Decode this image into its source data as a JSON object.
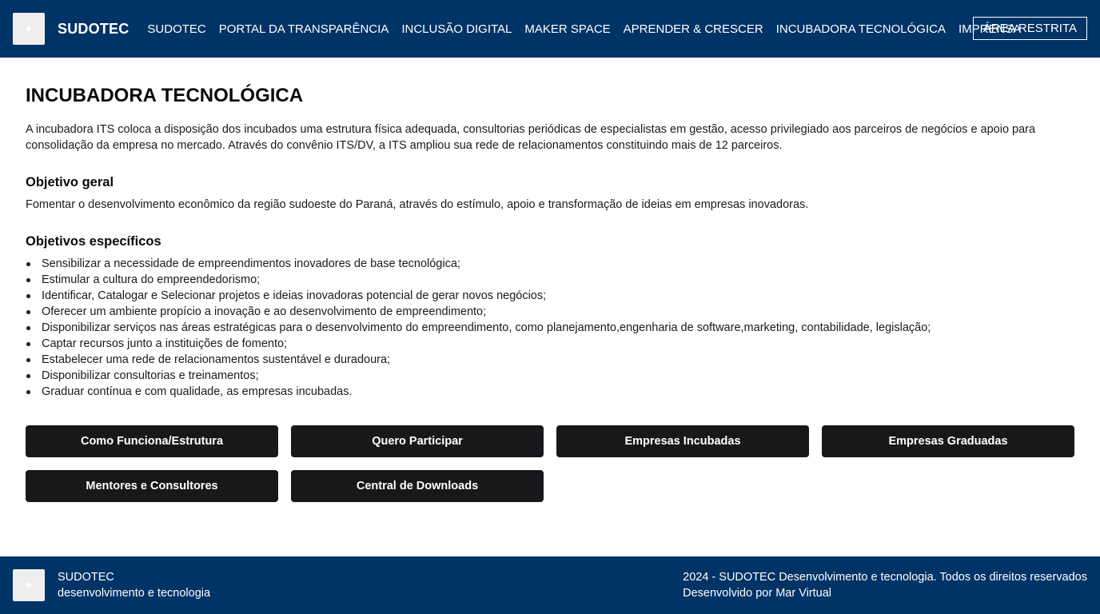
{
  "header": {
    "brand": "SUDOTEC",
    "nav": [
      "SUDOTEC",
      "PORTAL DA TRANSPARÊNCIA",
      "INCLUSÃO DIGITAL",
      "MAKER SPACE",
      "APRENDER & CRESCER",
      "INCUBADORA TECNOLÓGICA",
      "IMPRENSA"
    ],
    "restricted_label": "ÁREA RESTRITA"
  },
  "main": {
    "title": "INCUBADORA TECNOLÓGICA",
    "intro": "A incubadora ITS coloca a disposição dos incubados uma estrutura física adequada, consultorias periódicas de especialistas em gestão, acesso privilegiado aos parceiros de negócios e apoio para consolidação da empresa no mercado. Através do convênio ITS/DV, a ITS ampliou sua rede de relacionamentos constituindo mais de 12 parceiros.",
    "general_heading": "Objetivo geral",
    "general_text": "Fomentar o desenvolvimento econômico da região sudoeste do Paraná, através do estímulo, apoio e transformação de ideias em empresas inovadoras.",
    "specific_heading": "Objetivos específicos",
    "specific_items": [
      "Sensibilizar a necessidade de empreendimentos inovadores de base tecnológica;",
      "Estimular a cultura do empreendedorismo;",
      "Identificar, Catalogar e Selecionar projetos e ideias inovadoras potencial de gerar novos negócios;",
      "Oferecer um ambiente propício a inovação e ao desenvolvimento de empreendimento;",
      "Disponibilizar serviços nas áreas estratégicas para o desenvolvimento do empreendimento, como planejamento,engenharia de software,marketing, contabilidade, legislação;",
      "Captar recursos junto a instituições de fomento;",
      "Estabelecer uma rede de relacionamentos sustentável e duradoura;",
      "Disponibilizar consultorias e treinamentos;",
      "Graduar contínua e com qualidade, as empresas incubadas."
    ],
    "buttons": [
      "Como Funciona/Estrutura",
      "Quero Participar",
      "Empresas Incubadas",
      "Empresas Graduadas",
      "Mentores e Consultores",
      "Central de Downloads"
    ]
  },
  "footer": {
    "brand_line1": "SUDOTEC",
    "brand_line2": "desenvolvimento e tecnologia",
    "copyright": "2024 - SUDOTEC Desenvolvimento e tecnologia. Todos os direitos reservados",
    "credit": "Desenvolvido por Mar Virtual"
  },
  "colors": {
    "header_bg": "#003366",
    "button_bg": "#18181b"
  }
}
